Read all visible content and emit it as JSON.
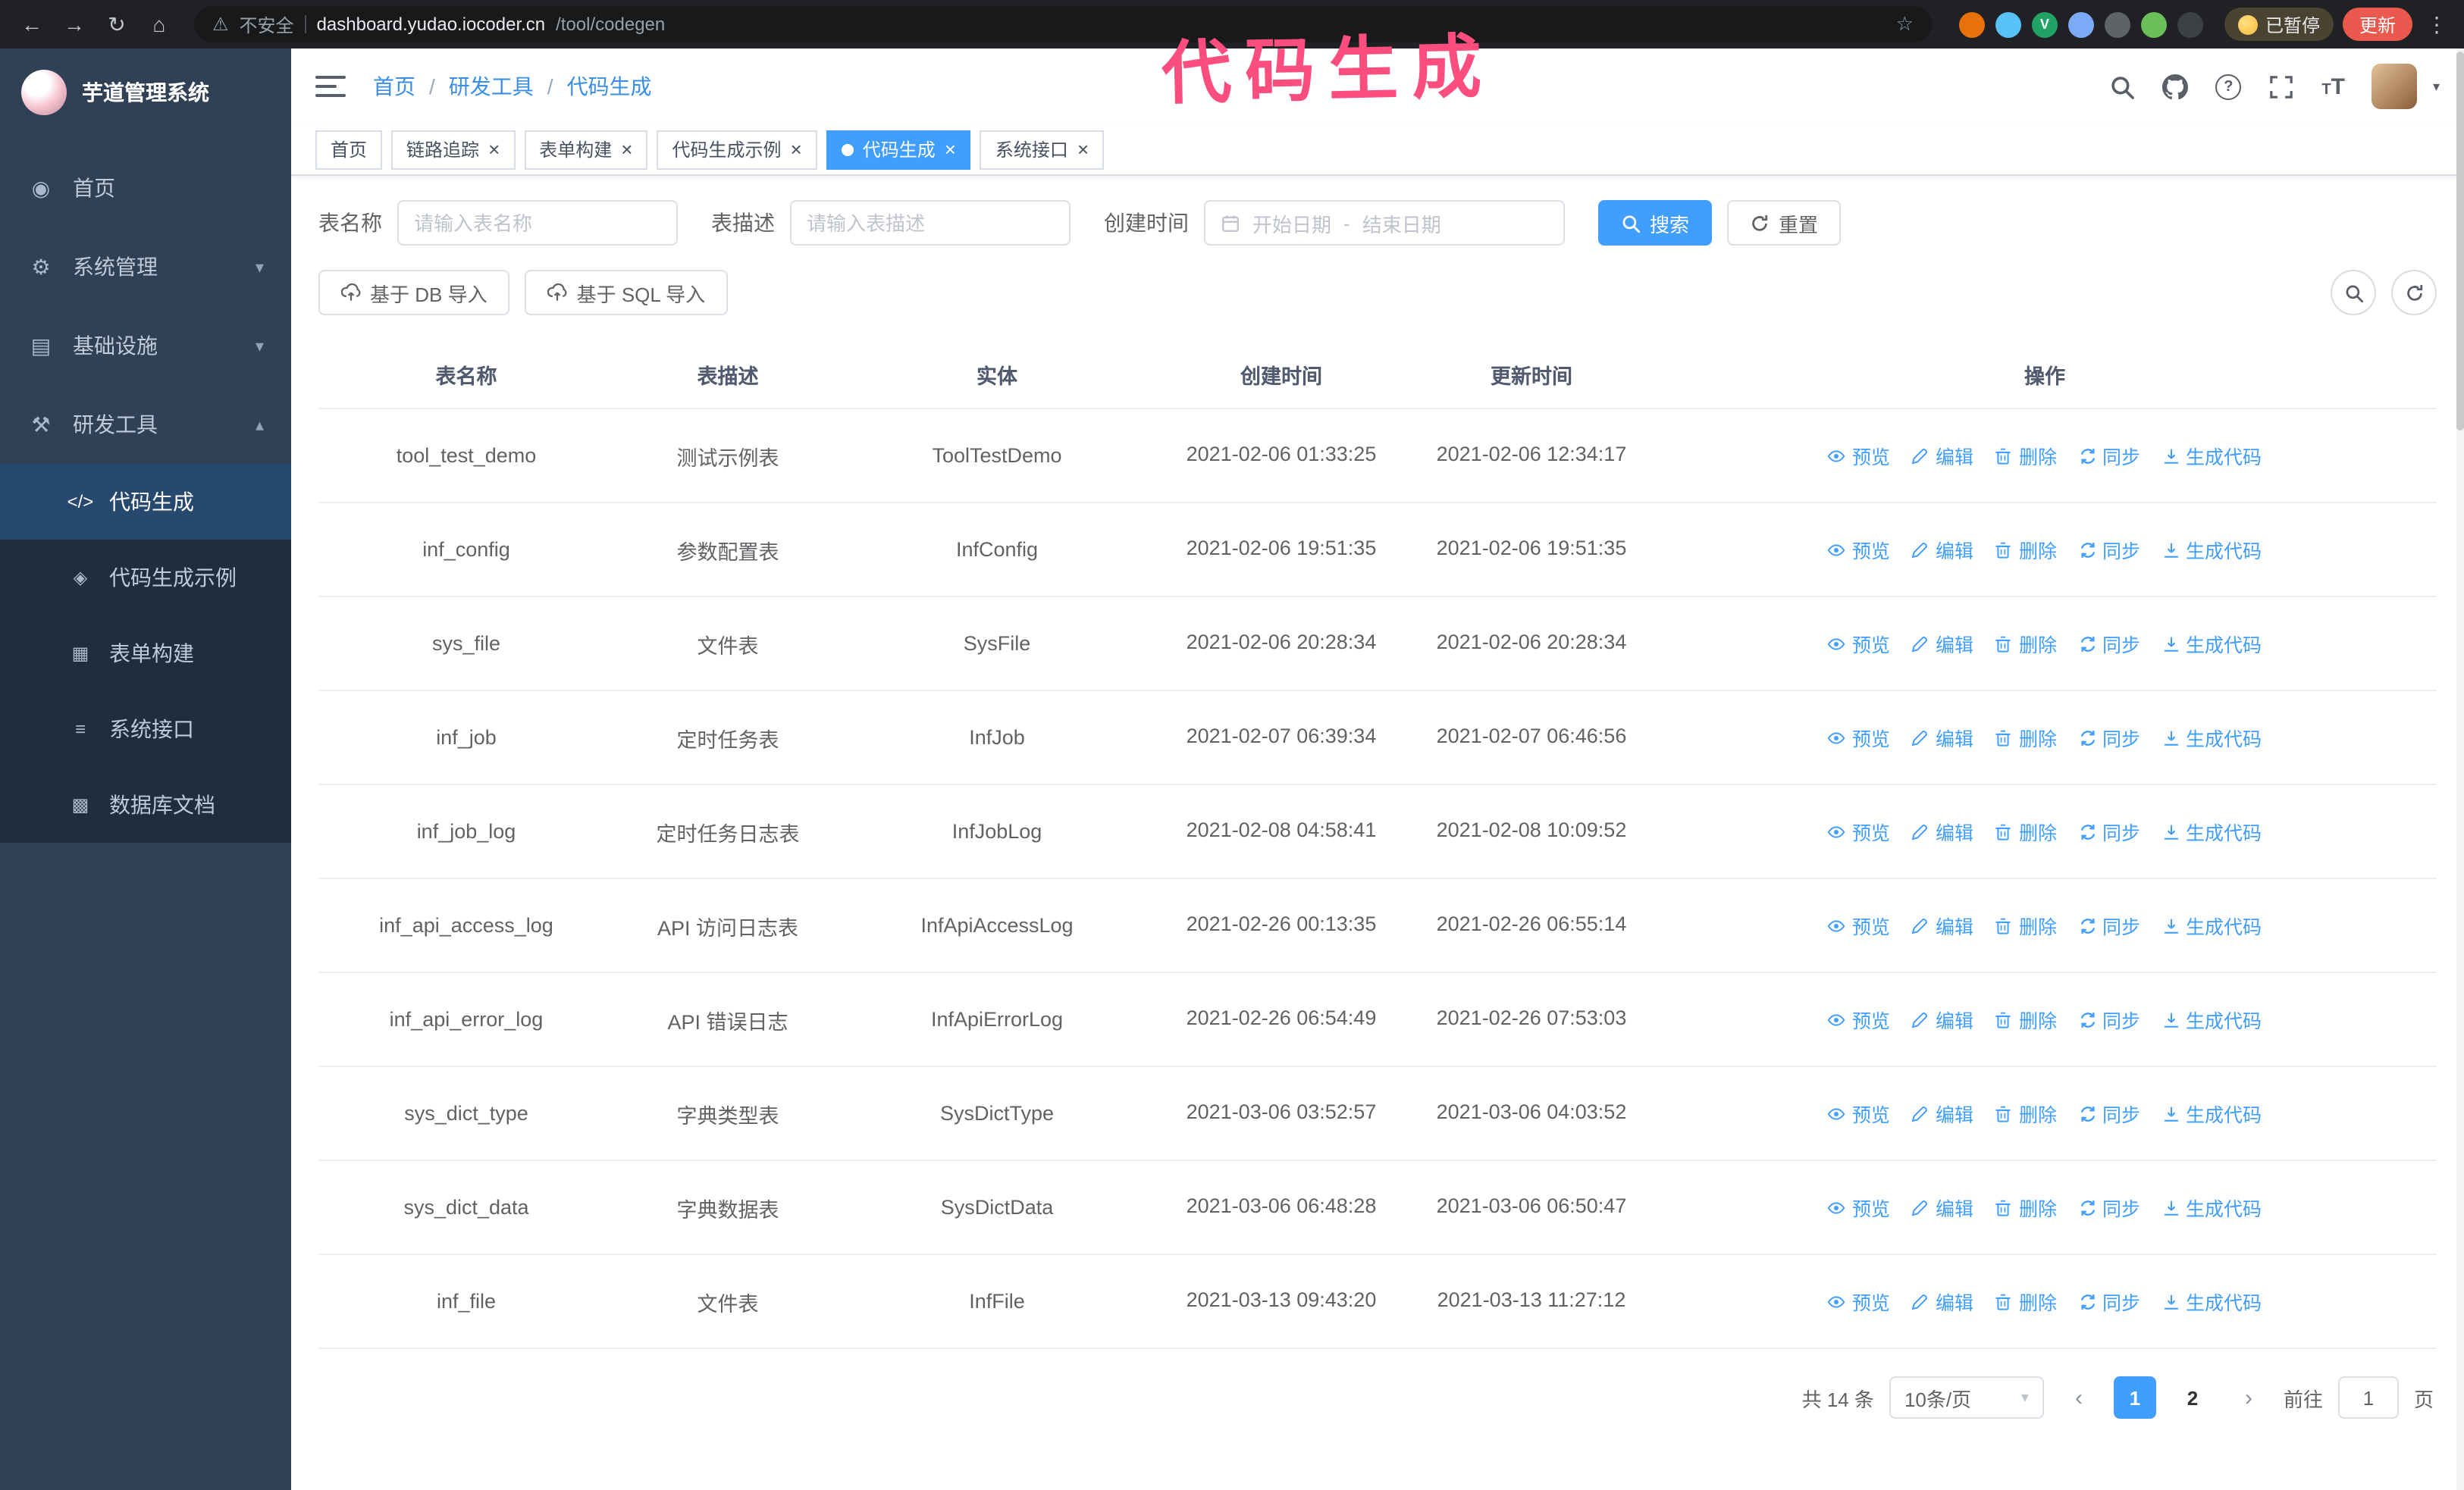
{
  "annotation": {
    "text": "代码生成",
    "color": "#fb4e7f"
  },
  "browser": {
    "security_label": "不安全",
    "url_host": "dashboard.yudao.iocoder.cn",
    "url_path": "/tool/codegen",
    "paused_label": "已暂停",
    "update_label": "更新",
    "extensions": [
      {
        "name": "extension-icon-1",
        "color": "#e8710a",
        "glyph": ""
      },
      {
        "name": "extension-icon-2",
        "color": "#58c1f5",
        "glyph": ""
      },
      {
        "name": "extension-icon-3",
        "color": "#21a366",
        "glyph": "V"
      },
      {
        "name": "extension-icon-4",
        "color": "#7baaf7",
        "glyph": ""
      },
      {
        "name": "extension-icon-5",
        "color": "#5f6368",
        "glyph": ""
      },
      {
        "name": "extension-icon-6",
        "color": "#6bbf59",
        "glyph": ""
      },
      {
        "name": "extension-icon-7",
        "color": "#3c4043",
        "glyph": ""
      }
    ]
  },
  "icons": {
    "back": "←",
    "forward": "→",
    "reload": "↻",
    "home": "⌂",
    "warning": "⚠",
    "star": "☆",
    "kebab": "⋮",
    "menu_home": "◉",
    "menu_system": "⚙",
    "menu_infra": "▤",
    "menu_tools": "⚒",
    "sub_codegen": "</>",
    "sub_example": "◈",
    "sub_form": "▦",
    "sub_api": "≡",
    "sub_db": "▩",
    "chevron_down": "▾",
    "chevron_up": "▴",
    "close": "×",
    "caret": "▾",
    "prev": "‹",
    "next": "›"
  },
  "sidebar": {
    "logo_title": "芋道管理系统",
    "items": [
      {
        "label": "首页"
      },
      {
        "label": "系统管理"
      },
      {
        "label": "基础设施"
      },
      {
        "label": "研发工具"
      }
    ],
    "subitems": [
      {
        "label": "代码生成",
        "active": true
      },
      {
        "label": "代码生成示例"
      },
      {
        "label": "表单构建"
      },
      {
        "label": "系统接口"
      },
      {
        "label": "数据库文档"
      }
    ]
  },
  "header": {
    "breadcrumb": [
      "首页",
      "研发工具",
      "代码生成"
    ],
    "separator": "/"
  },
  "tabs": [
    {
      "label": "首页",
      "closable": false,
      "active": false
    },
    {
      "label": "链路追踪",
      "closable": true,
      "active": false
    },
    {
      "label": "表单构建",
      "closable": true,
      "active": false
    },
    {
      "label": "代码生成示例",
      "closable": true,
      "active": false
    },
    {
      "label": "代码生成",
      "closable": true,
      "active": true
    },
    {
      "label": "系统接口",
      "closable": true,
      "active": false
    }
  ],
  "filters": {
    "table_name_label": "表名称",
    "table_name_placeholder": "请输入表名称",
    "table_desc_label": "表描述",
    "table_desc_placeholder": "请输入表描述",
    "create_time_label": "创建时间",
    "date_start_placeholder": "开始日期",
    "date_separator": "-",
    "date_end_placeholder": "结束日期",
    "search_label": "搜索",
    "reset_label": "重置"
  },
  "toolbar": {
    "import_db_label": "基于 DB 导入",
    "import_sql_label": "基于 SQL 导入"
  },
  "table": {
    "columns": [
      "表名称",
      "表描述",
      "实体",
      "创建时间",
      "更新时间",
      "操作"
    ],
    "actions": [
      "预览",
      "编辑",
      "删除",
      "同步",
      "生成代码"
    ],
    "action_icons": [
      "eye-icon",
      "edit-icon",
      "delete-icon",
      "sync-icon",
      "download-icon"
    ],
    "rows": [
      {
        "name": "tool_test_demo",
        "desc": "测试示例表",
        "entity": "ToolTestDemo",
        "created": "2021-02-06 01:33:25",
        "updated": "2021-02-06 12:34:17"
      },
      {
        "name": "inf_config",
        "desc": "参数配置表",
        "entity": "InfConfig",
        "created": "2021-02-06 19:51:35",
        "updated": "2021-02-06 19:51:35"
      },
      {
        "name": "sys_file",
        "desc": "文件表",
        "entity": "SysFile",
        "created": "2021-02-06 20:28:34",
        "updated": "2021-02-06 20:28:34"
      },
      {
        "name": "inf_job",
        "desc": "定时任务表",
        "entity": "InfJob",
        "created": "2021-02-07 06:39:34",
        "updated": "2021-02-07 06:46:56"
      },
      {
        "name": "inf_job_log",
        "desc": "定时任务日志表",
        "entity": "InfJobLog",
        "created": "2021-02-08 04:58:41",
        "updated": "2021-02-08 10:09:52"
      },
      {
        "name": "inf_api_access_log",
        "desc": "API 访问日志表",
        "entity": "InfApiAccessLog",
        "created": "2021-02-26 00:13:35",
        "updated": "2021-02-26 06:55:14"
      },
      {
        "name": "inf_api_error_log",
        "desc": "API 错误日志",
        "entity": "InfApiErrorLog",
        "created": "2021-02-26 06:54:49",
        "updated": "2021-02-26 07:53:03"
      },
      {
        "name": "sys_dict_type",
        "desc": "字典类型表",
        "entity": "SysDictType",
        "created": "2021-03-06 03:52:57",
        "updated": "2021-03-06 04:03:52"
      },
      {
        "name": "sys_dict_data",
        "desc": "字典数据表",
        "entity": "SysDictData",
        "created": "2021-03-06 06:48:28",
        "updated": "2021-03-06 06:50:47"
      },
      {
        "name": "inf_file",
        "desc": "文件表",
        "entity": "InfFile",
        "created": "2021-03-13 09:43:20",
        "updated": "2021-03-13 11:27:12"
      }
    ]
  },
  "pagination": {
    "total_label": "共 14 条",
    "page_size_label": "10条/页",
    "pages": [
      "1",
      "2"
    ],
    "active_page": "1",
    "goto_label": "前往",
    "goto_value": "1",
    "page_suffix": "页"
  }
}
